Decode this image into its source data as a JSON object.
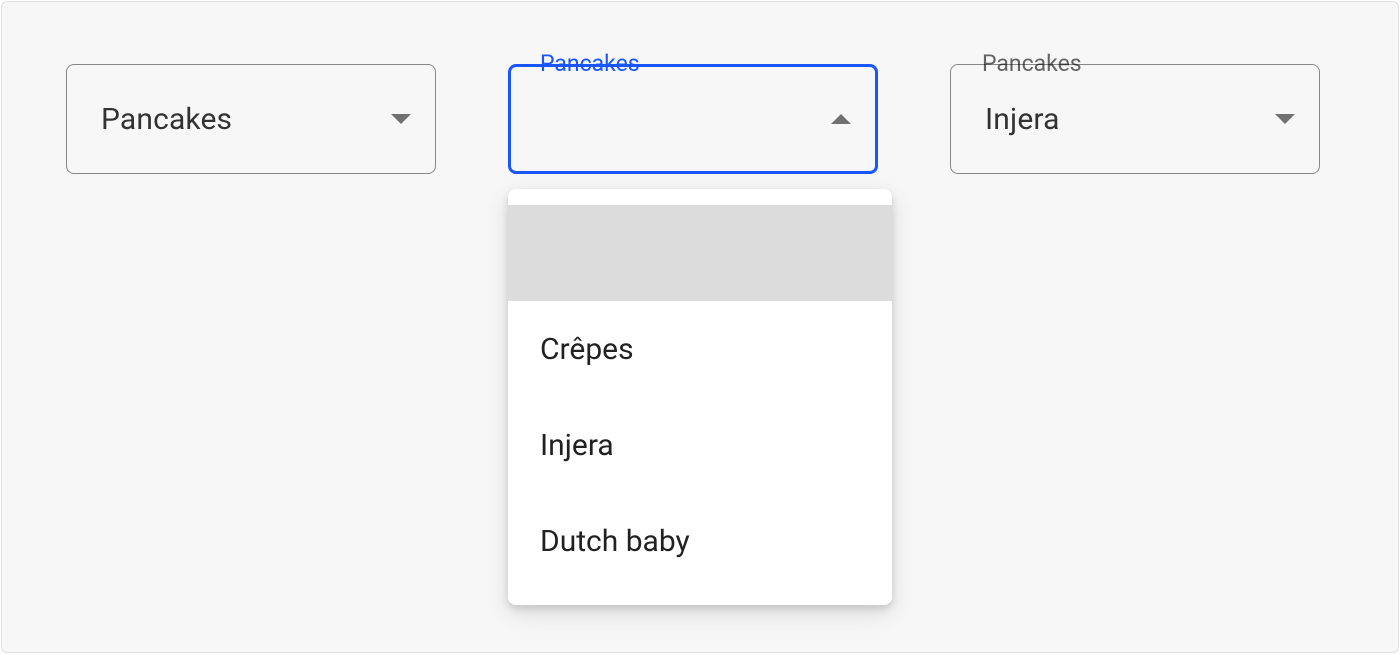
{
  "select1": {
    "label": "Pancakes",
    "value": "Pancakes"
  },
  "select2": {
    "label": "Pancakes",
    "value": "",
    "options": [
      "",
      "Crêpes",
      "Injera",
      "Dutch baby"
    ]
  },
  "select3": {
    "label": "Pancakes",
    "value": "Injera"
  }
}
